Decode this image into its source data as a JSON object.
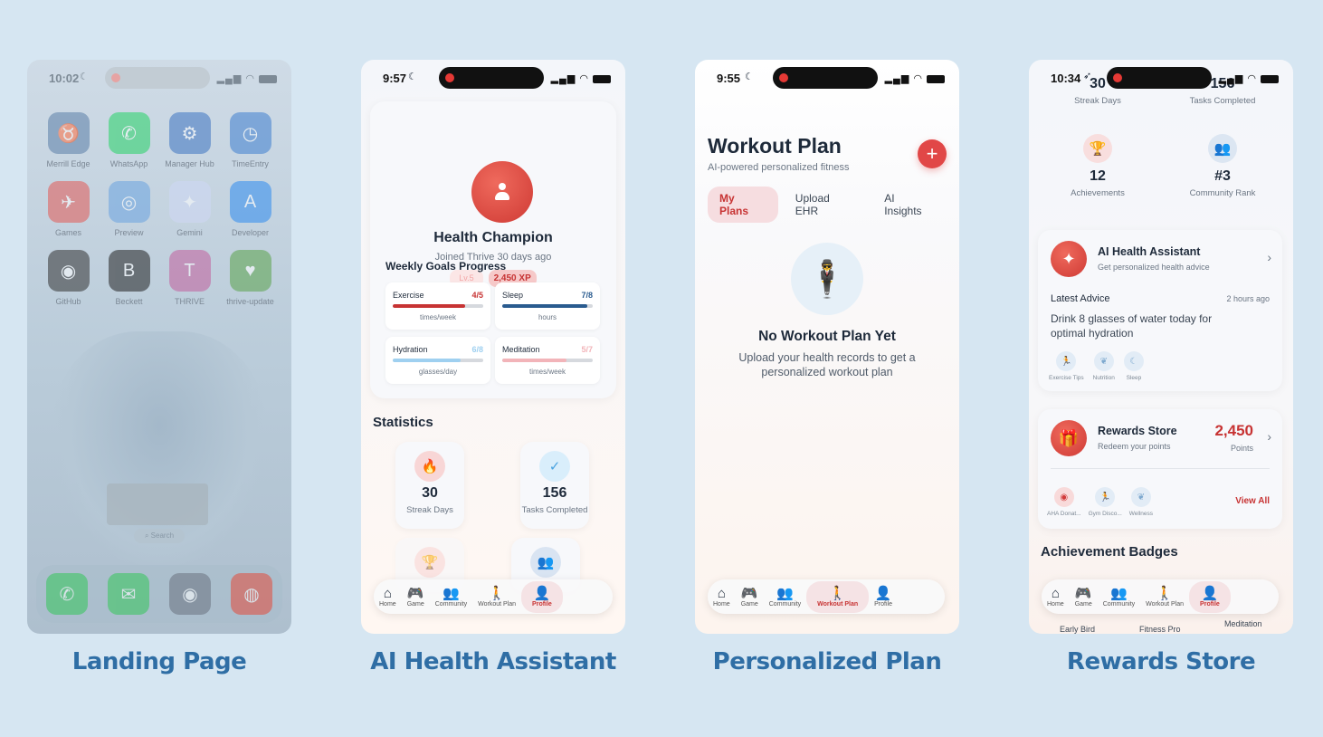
{
  "captions": [
    "Landing Page",
    "AI Health Assistant",
    "Personalized Plan",
    "Rewards Store"
  ],
  "landing": {
    "time": "10:02",
    "apps": [
      {
        "label": "Merrill Edge",
        "color": "#5b7fa8",
        "glyph": "♉"
      },
      {
        "label": "WhatsApp",
        "color": "#25d366",
        "glyph": "✆"
      },
      {
        "label": "Manager Hub",
        "color": "#3d74c2",
        "glyph": "⚙"
      },
      {
        "label": "TimeEntry",
        "color": "#3f7fd0",
        "glyph": "◷"
      },
      {
        "label": "Games",
        "color": "#e35a56",
        "glyph": "✈"
      },
      {
        "label": "Preview",
        "color": "#6aa3e0",
        "glyph": "◎"
      },
      {
        "label": "Gemini",
        "color": "#cfd8f5",
        "glyph": "✦"
      },
      {
        "label": "Developer",
        "color": "#2f8cf0",
        "glyph": "A"
      },
      {
        "label": "GitHub",
        "color": "#333333",
        "glyph": "◉"
      },
      {
        "label": "Beckett",
        "color": "#222222",
        "glyph": "B"
      },
      {
        "label": "THRIVE",
        "color": "#c25f9d",
        "glyph": "T"
      },
      {
        "label": "thrive-update",
        "color": "#5aa34a",
        "glyph": "♥"
      }
    ],
    "search": "Search",
    "dock": [
      {
        "name": "phone",
        "color": "#34c759",
        "glyph": "✆"
      },
      {
        "name": "messages",
        "color": "#34c759",
        "glyph": "✉"
      },
      {
        "name": "camera",
        "color": "#6b7280",
        "glyph": "◉"
      },
      {
        "name": "chrome",
        "color": "#e44b3a",
        "glyph": "◍"
      }
    ]
  },
  "assistant": {
    "time": "9:57",
    "name": "Health Champion",
    "joined": "Joined Thrive 30 days ago",
    "level": "Lv.5",
    "xp": "2,450 XP",
    "goals_title": "Weekly Goals Progress",
    "goals": [
      {
        "name": "Exercise",
        "value": "4/5",
        "unit": "times/week",
        "progress": 0.8,
        "color": "#c73333"
      },
      {
        "name": "Sleep",
        "value": "7/8",
        "unit": "hours",
        "progress": 0.94,
        "color": "#2a5b8f"
      },
      {
        "name": "Hydration",
        "value": "6/8",
        "unit": "glasses/day",
        "progress": 0.75,
        "color": "#9fd0f0"
      },
      {
        "name": "Meditation",
        "value": "5/7",
        "unit": "times/week",
        "progress": 0.71,
        "color": "#f2b4b9"
      }
    ],
    "statistics_title": "Statistics",
    "stats": [
      {
        "value": "30",
        "label": "Streak Days"
      },
      {
        "value": "156",
        "label": "Tasks Completed"
      }
    ]
  },
  "plan": {
    "time": "9:55",
    "title": "Workout Plan",
    "subtitle": "AI-powered personalized fitness",
    "tabs": [
      "My Plans",
      "Upload EHR",
      "AI Insights"
    ],
    "empty_title": "No Workout Plan Yet",
    "empty_subtitle": "Upload your health records to get a personalized workout plan"
  },
  "rewards": {
    "time": "10:34",
    "top_stats": [
      {
        "value": "30",
        "label": "Streak Days"
      },
      {
        "value": "156",
        "label": "Tasks Completed"
      },
      {
        "value": "12",
        "label": "Achievements"
      },
      {
        "value": "#3",
        "label": "Community Rank"
      }
    ],
    "assistant_title": "AI Health Assistant",
    "assistant_sub": "Get personalized health advice",
    "latest_label": "Latest Advice",
    "latest_time": "2 hours ago",
    "advice": "Drink 8 glasses of water today for optimal hydration",
    "advice_chips": [
      "Exercise Tips",
      "Nutrition",
      "Sleep"
    ],
    "store_title": "Rewards Store",
    "store_sub": "Redeem your points",
    "points": "2,450",
    "points_label": "Points",
    "store_chips": [
      "AHA Donat...",
      "Gym Disco...",
      "Wellness"
    ],
    "view_all": "View All",
    "badges_title": "Achievement Badges",
    "badge_names": [
      "Early Bird",
      "Fitness Pro",
      "Meditation"
    ]
  },
  "tabbar": [
    {
      "label": "Home",
      "glyph": "⌂"
    },
    {
      "label": "Game",
      "glyph": "🎮"
    },
    {
      "label": "Community",
      "glyph": "👥"
    },
    {
      "label": "Workout Plan",
      "glyph": "🚶"
    },
    {
      "label": "Profile",
      "glyph": "👤"
    }
  ]
}
